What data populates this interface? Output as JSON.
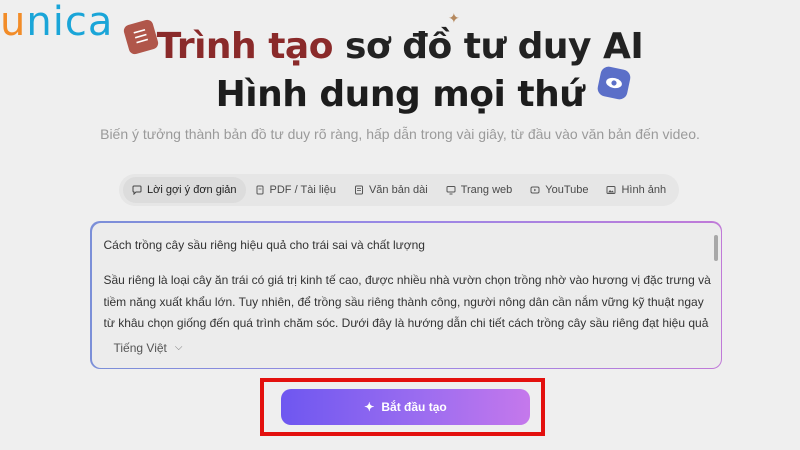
{
  "logo": {
    "first_letter": "u",
    "rest": "nica"
  },
  "hero": {
    "title_accent": "Trình tạo",
    "title_rest": " sơ đồ tư duy AI",
    "title_line2": "Hình dung mọi thứ",
    "subtitle": "Biến ý tưởng thành bản đồ tư duy rõ ràng, hấp dẫn trong vài giây, từ đầu vào văn bản đến video."
  },
  "tabs": [
    {
      "label": "Lời gợi ý đơn giản",
      "icon": "chat-bubble-icon",
      "active": true
    },
    {
      "label": "PDF / Tài liệu",
      "icon": "file-icon"
    },
    {
      "label": "Văn bản dài",
      "icon": "document-lines-icon"
    },
    {
      "label": "Trang web",
      "icon": "monitor-icon"
    },
    {
      "label": "YouTube",
      "icon": "play-icon"
    },
    {
      "label": "Hình ảnh",
      "icon": "image-icon"
    }
  ],
  "editor": {
    "line_title": "Cách trồng cây sầu riêng hiệu quả cho trái sai và chất lượng",
    "paragraph": "Sầu riêng là loại cây ăn trái có giá trị kinh tế cao, được nhiều nhà vườn chọn trồng nhờ vào hương vị đặc trưng và tiềm năng xuất khẩu lớn. Tuy nhiên, để trồng sầu riêng thành công, người nông dân cần nắm vững kỹ thuật ngay từ khâu chọn giống đến quá trình chăm sóc. Dưới đây là hướng dẫn chi tiết cách trồng cây sầu riêng đạt hiệu quả cao."
  },
  "language": {
    "selected": "Tiếng Việt"
  },
  "actions": {
    "start_label": "Bắt đầu tạo"
  },
  "colors": {
    "accent_title": "#8a2a2a",
    "button_gradient_start": "#6e57f0",
    "button_gradient_end": "#c578ec",
    "highlight_border": "#e3100e"
  }
}
